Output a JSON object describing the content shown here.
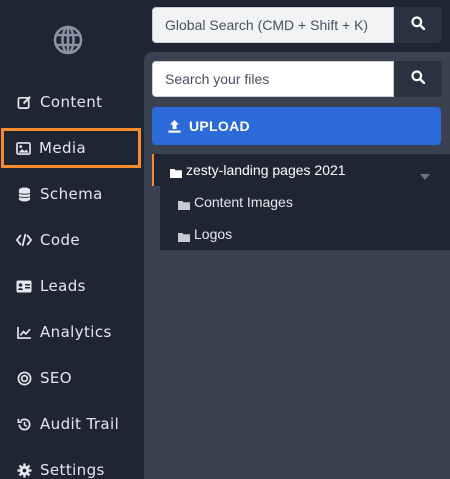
{
  "sidebar": {
    "items": [
      {
        "label": "Content",
        "icon": "edit-icon"
      },
      {
        "label": "Media",
        "icon": "image-icon"
      },
      {
        "label": "Schema",
        "icon": "database-icon"
      },
      {
        "label": "Code",
        "icon": "code-icon"
      },
      {
        "label": "Leads",
        "icon": "id-card-icon"
      },
      {
        "label": "Analytics",
        "icon": "chart-line-icon"
      },
      {
        "label": "SEO",
        "icon": "target-icon"
      },
      {
        "label": "Audit Trail",
        "icon": "history-icon"
      },
      {
        "label": "Settings",
        "icon": "gear-icon"
      }
    ],
    "active": "Media"
  },
  "header": {
    "global_search_placeholder": "Global Search (CMD + Shift + K)"
  },
  "media": {
    "file_search_placeholder": "Search your files",
    "upload_label": "UPLOAD",
    "tree": {
      "root": "zesty-landing pages 2021",
      "children": [
        "Content Images",
        "Logos"
      ]
    }
  },
  "colors": {
    "accent": "#f58d2d",
    "upload": "#2b6ad8",
    "sidebar_bg": "#1f2533",
    "panel_bg": "#3a4150"
  }
}
